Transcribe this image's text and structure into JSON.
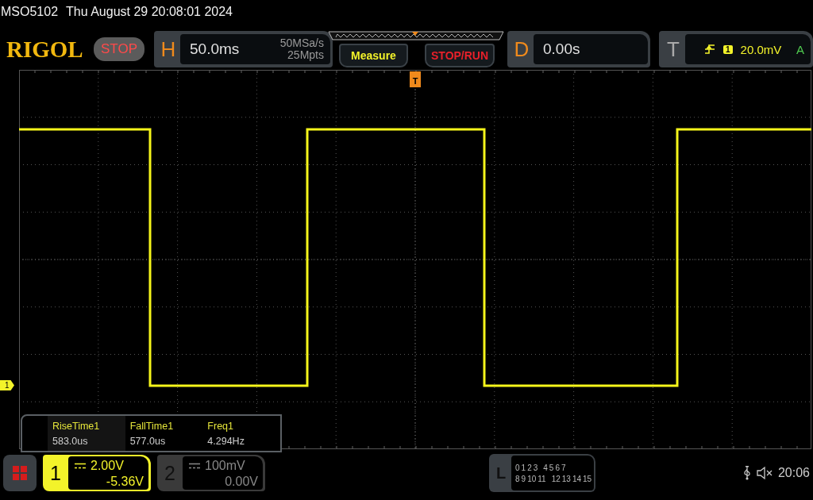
{
  "title_bar": {
    "model": "MSO5102",
    "datetime": "Thu August 29 20:08:01 2024"
  },
  "header": {
    "logo": "RIGOL",
    "run_state": "STOP",
    "horizontal": {
      "label": "H",
      "timebase": "50.0ms",
      "sample_rate": "50MSa/s",
      "memory_depth": "25Mpts"
    },
    "buttons": [
      {
        "label": "Measure",
        "kind": "menu"
      },
      {
        "label": "STOP/RUN",
        "kind": "run"
      }
    ],
    "delay": {
      "label": "D",
      "value": "0.00s"
    },
    "trigger": {
      "label": "T",
      "channel": "1",
      "level": "20.0mV",
      "mode": "A"
    }
  },
  "grid": {
    "trigger_marker": "T",
    "channel_marker": "1"
  },
  "measurements": [
    {
      "name": "RiseTime1",
      "value": "583.0us"
    },
    {
      "name": "FallTime1",
      "value": "577.0us"
    },
    {
      "name": "Freq1",
      "value": "4.294Hz"
    }
  ],
  "channels": [
    {
      "number": "1",
      "scale": "2.00V",
      "offset": "-5.36V",
      "on": true
    },
    {
      "number": "2",
      "scale": "100mV",
      "offset": "0.00V",
      "on": false
    }
  ],
  "logic": {
    "label": "L",
    "row_1": [
      "0",
      "1",
      "2",
      "3",
      "4",
      "5",
      "6",
      "7"
    ],
    "row_2": [
      "8",
      "9",
      "10",
      "11",
      "12",
      "13",
      "14",
      "15"
    ]
  },
  "status": {
    "time": "20:06"
  }
}
